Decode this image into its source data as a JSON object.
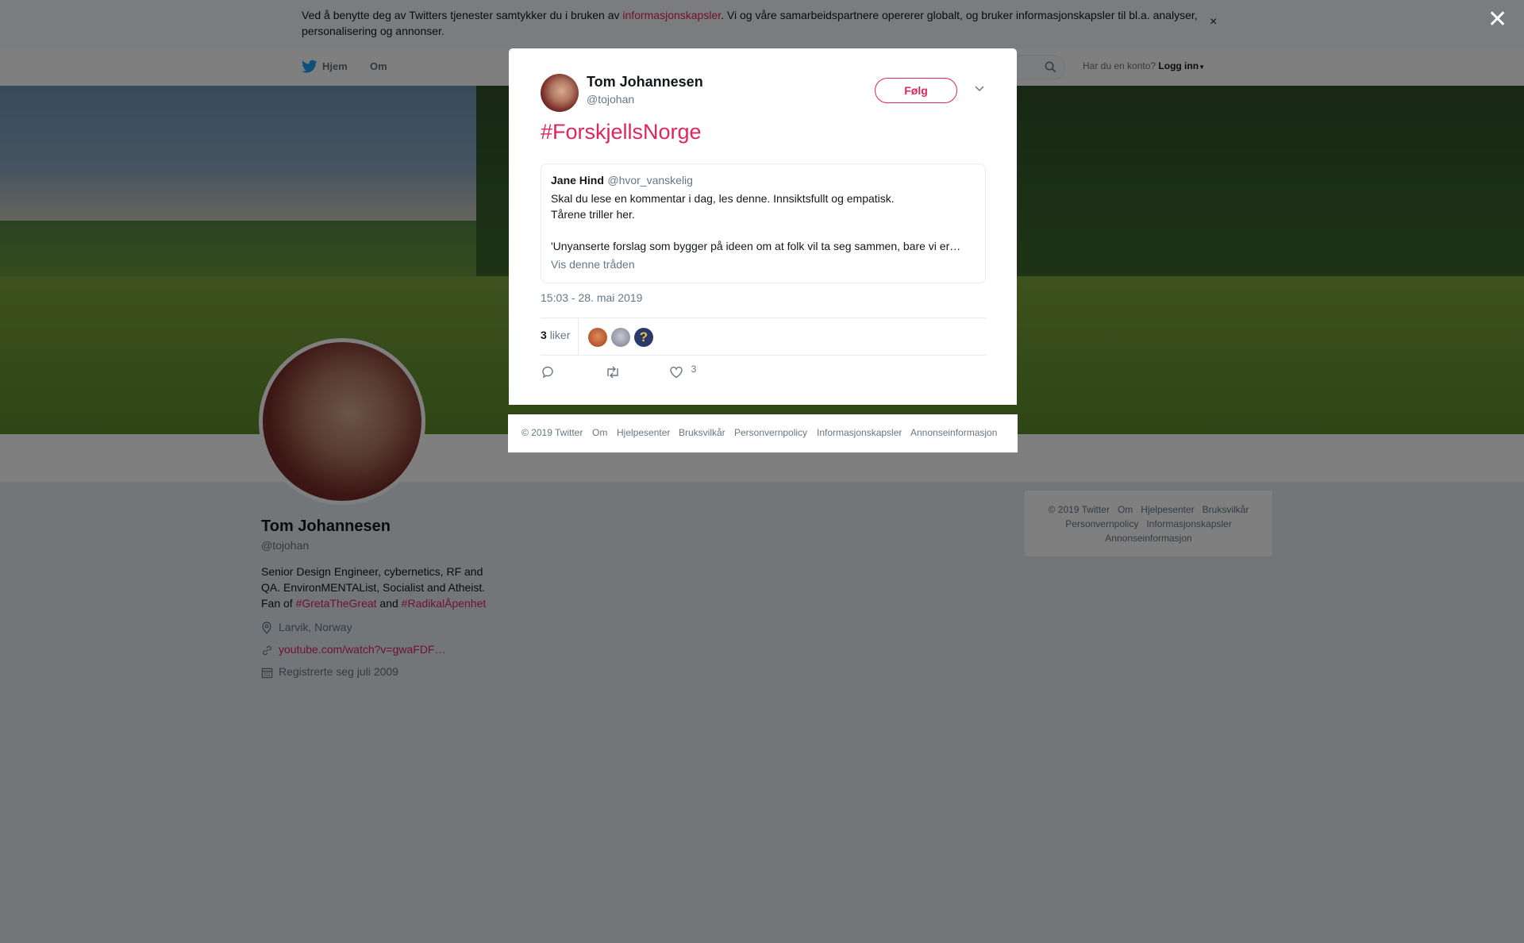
{
  "cookie_bar": {
    "text_before": "Ved å benytte deg av Twitters tjenester samtykker du i bruken av ",
    "link": "informasjonskapsler",
    "text_after": ". Vi og våre samarbeidspartnere opererer globalt, og bruker informasjonskapsler til bl.a. analyser, personalisering og annonser.",
    "close": "×"
  },
  "nav": {
    "home": "Hjem",
    "about": "Om",
    "login_prompt": "Har du en konto?",
    "login": "Logg inn"
  },
  "profile": {
    "name": "Tom Johannesen",
    "handle": "@tojohan",
    "bio_before": "Senior Design Engineer, cybernetics, RF and QA. EnvironMENTAList, Socialist and Atheist. Fan of ",
    "bio_tag1": "#GretaTheGreat",
    "bio_mid": " and ",
    "bio_tag2": "#RadikalÅpenhet",
    "location": "Larvik, Norway",
    "url": "youtube.com/watch?v=gwaFDF…",
    "joined": "Registrerte seg juli 2009"
  },
  "right_footer": {
    "items": [
      "© 2019 Twitter",
      "Om",
      "Hjelpesenter",
      "Bruksvilkår",
      "Personvernpolicy",
      "Informasjonskapsler",
      "Annonseinformasjon"
    ]
  },
  "overlay": {
    "close": "✕"
  },
  "tweet": {
    "name": "Tom Johannesen",
    "handle": "@tojohan",
    "follow": "Følg",
    "text": "#ForskjellsNorge",
    "quote": {
      "name": "Jane Hind",
      "handle": "@hvor_vanskelig",
      "line1": "Skal du lese en kommentar i dag, les denne. Innsiktsfullt og empatisk.",
      "line2": "Tårene triller her.",
      "line3": "'Unyanserte forslag som bygger på ideen om at folk vil ta seg sammen, bare vi er…",
      "show_thread": "Vis denne tråden"
    },
    "timestamp": "15:03 - 28. mai 2019",
    "likes_count": "3",
    "likes_label": "liker",
    "like_action_count": "3"
  },
  "modal_footer": {
    "items": [
      "© 2019 Twitter",
      "Om",
      "Hjelpesenter",
      "Bruksvilkår",
      "Personvernpolicy",
      "Informasjonskapsler",
      "Annonseinformasjon"
    ]
  },
  "colors": {
    "accent": "#e0245e",
    "secondary_text": "#657786",
    "twitter_blue": "#1da1f2"
  }
}
